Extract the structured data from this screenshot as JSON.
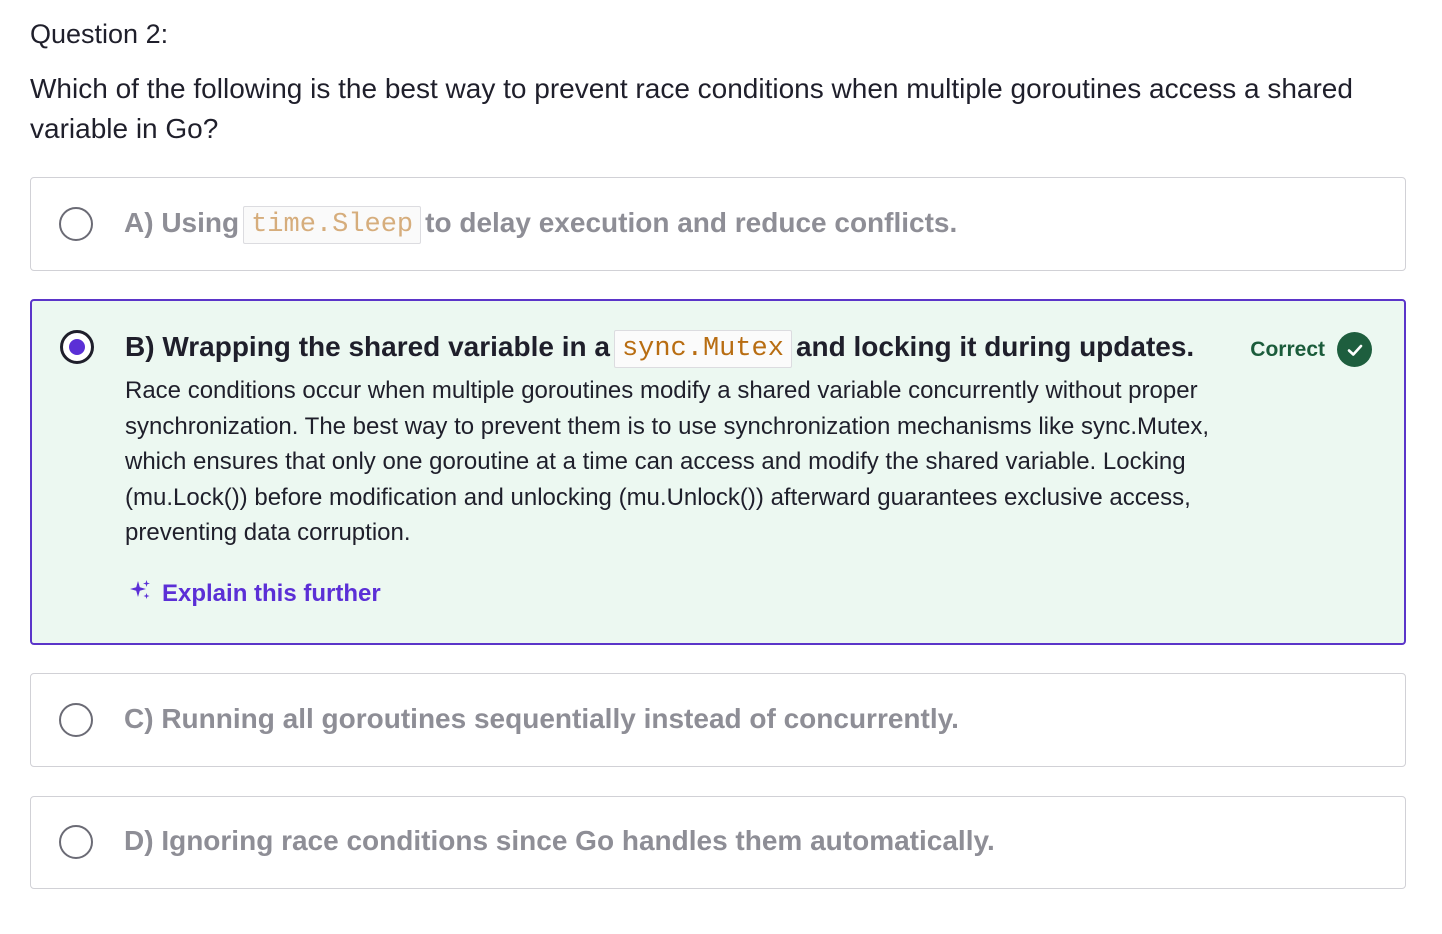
{
  "question": {
    "label": "Question 2:",
    "text": "Which of the following is the best way to prevent race conditions when multiple goroutines access a shared variable in Go?"
  },
  "options": [
    {
      "prefix": "A) Using",
      "code": "time.Sleep",
      "suffix": "to delay execution and reduce conflicts.",
      "selected": false
    },
    {
      "prefix": "B) Wrapping the shared variable in a",
      "code": "sync.Mutex",
      "suffix": "and locking it during updates.",
      "selected": true,
      "status": "Correct",
      "explanation": "Race conditions occur when multiple goroutines modify a shared variable concurrently without proper synchronization. The best way to prevent them is to use synchronization mechanisms like sync.Mutex, which ensures that only one goroutine at a time can access and modify the shared variable. Locking (mu.Lock()) before modification and unlocking (mu.Unlock()) afterward guarantees exclusive access, preventing data corruption.",
      "explain_link": "Explain this further"
    },
    {
      "text": "C) Running all goroutines sequentially instead of concurrently.",
      "selected": false
    },
    {
      "text": "D) Ignoring race conditions since Go handles them automatically.",
      "selected": false
    }
  ],
  "colors": {
    "accent": "#5b2fd6",
    "correct": "#1e5e3e",
    "selected_bg": "#ecf8f1",
    "muted_text": "#8e8e96"
  },
  "icons": {
    "correct": "check-circle-icon",
    "explain": "sparkle-icon"
  }
}
